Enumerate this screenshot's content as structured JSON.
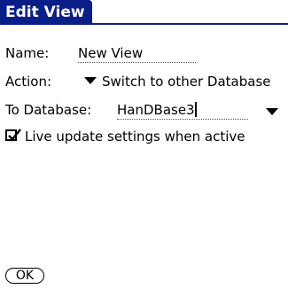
{
  "app": {
    "title": "Edit View"
  },
  "form": {
    "name_label": "Name:",
    "name_value": "New View",
    "action_label": "Action:",
    "action_value": "Switch to other Database",
    "to_database_label": "To Database:",
    "to_database_value": "HanDBase3",
    "live_update_label": "Live update settings when active",
    "live_update_checked": true
  },
  "buttons": {
    "ok_label": "OK"
  },
  "colors": {
    "title_bar": "#0a1e8a",
    "background": "#ffffff",
    "text": "#000000"
  },
  "icons": {
    "dropdown": "triangle-down-icon",
    "checkbox": "checkmark-icon"
  }
}
